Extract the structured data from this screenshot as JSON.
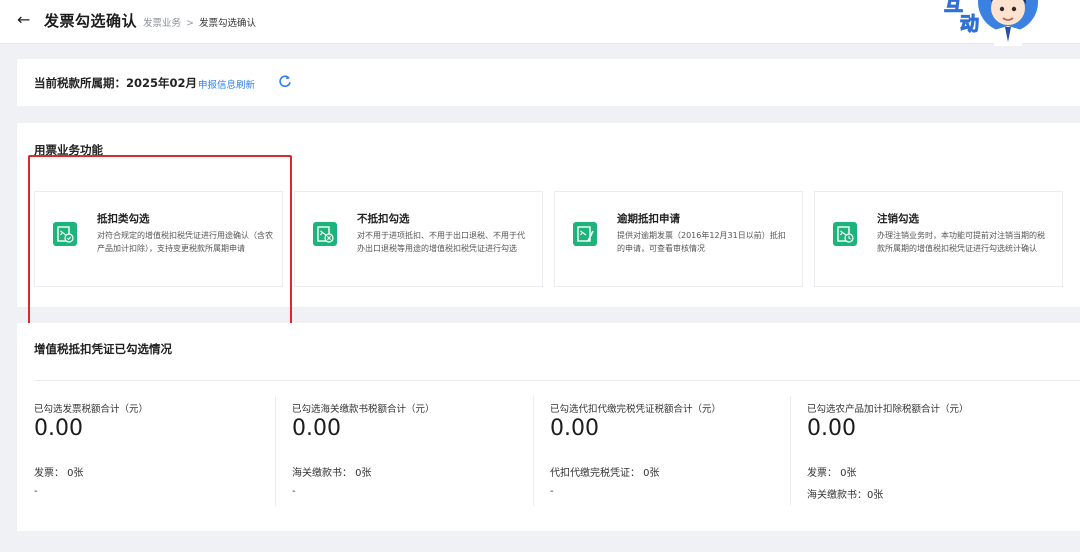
{
  "header": {
    "title": "发票勾选确认",
    "breadcrumb": [
      "发票业务",
      "发票勾选确认"
    ],
    "mascot_text": [
      "互",
      "动"
    ]
  },
  "period": {
    "label": "当前税款所属期：2025年02月",
    "refresh_link": "申报信息刷新"
  },
  "functions": {
    "title": "用票业务功能",
    "items": [
      {
        "name": "抵扣类勾选",
        "desc": "对符合规定的增值税扣税凭证进行用途确认（含农产品加计扣除），支持变更税款所属期申请",
        "icon": "deduction-check-icon"
      },
      {
        "name": "不抵扣勾选",
        "desc": "对不用于进项抵扣、不用于出口退税、不用于代办出口退税等用途的增值税扣税凭证进行勾选",
        "icon": "no-deduction-icon"
      },
      {
        "name": "逾期抵扣申请",
        "desc": "提供对逾期发票（2016年12月31日以前）抵扣的申请，可查看审核情况",
        "icon": "overdue-deduction-icon"
      },
      {
        "name": "注销勾选",
        "desc": "办理注销业务时，本功能可提前对注销当期的税款所属期的增值税扣税凭证进行勾选统计确认",
        "icon": "cancel-check-icon"
      }
    ]
  },
  "summary": {
    "title": "增值税抵扣凭证已勾选情况",
    "columns": [
      {
        "label": "已勾选发票税额合计（元）",
        "value": "0.00",
        "lines": [
          "发票：  0张",
          "-"
        ]
      },
      {
        "label": "已勾选海关缴款书税额合计（元）",
        "value": "0.00",
        "lines": [
          "海关缴款书：  0张",
          "-"
        ]
      },
      {
        "label": "已勾选代扣代缴完税凭证税额合计（元）",
        "value": "0.00",
        "lines": [
          "代扣代缴完税凭证：  0张",
          "-"
        ]
      },
      {
        "label": "已勾选农产品加计扣除税额合计（元）",
        "value": "0.00",
        "lines": [
          "发票：  0张",
          "海关缴款书：0张"
        ]
      }
    ]
  },
  "colors": {
    "accent_green": "#1cb47a",
    "link_blue": "#2f7ff0",
    "highlight_red": "#e0262d"
  }
}
